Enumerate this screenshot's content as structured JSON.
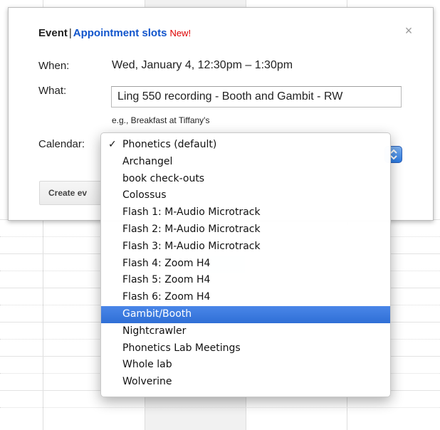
{
  "popup": {
    "tab_event": "Event",
    "separator": "|",
    "tab_appointment_slots": "Appointment slots",
    "new_badge": "New!",
    "close_symbol": "×",
    "when_label": "When:",
    "when_value": "Wed, January 4, 12:30pm – 1:30pm",
    "what_label": "What:",
    "what_value": "Ling 550 recording - Booth and Gambit - RW",
    "what_hint": "e.g., Breakfast at Tiffany's",
    "calendar_label": "Calendar:",
    "create_button_label": "Create ev"
  },
  "calendar_menu": {
    "checkmark": "✓",
    "selected_index": 0,
    "highlighted_index": 10,
    "options": [
      "Phonetics (default)",
      "Archangel",
      "book check-outs",
      "Colossus",
      "Flash 1: M-Audio Microtrack",
      "Flash 2: M-Audio Microtrack",
      "Flash 3: M-Audio Microtrack",
      "Flash 4: Zoom H4",
      "Flash 5: Zoom H4",
      "Flash 6: Zoom H4",
      "Gambit/Booth",
      "Nightcrawler",
      "Phonetics Lab Meetings",
      "Whole lab",
      "Wolverine"
    ]
  },
  "colors": {
    "link_blue": "#1155cc",
    "new_red": "#dd0000",
    "menu_highlight": "#3875d7",
    "select_button_blue": "#2a7ae2"
  },
  "icons": {
    "close": "close-icon",
    "check": "checkmark-icon",
    "select_arrows": "select-arrows-icon"
  }
}
